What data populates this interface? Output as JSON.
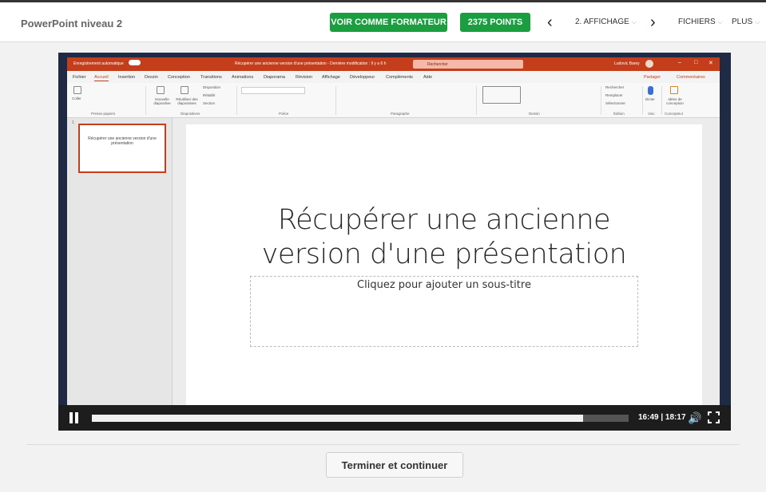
{
  "header": {
    "course_title": "PowerPoint niveau 2",
    "trainer_button": "VOIR COMME FORMATEUR",
    "points_button": "2375 POINTS",
    "lesson_label": "2. AFFICHAGE",
    "files_label": "FICHIERS",
    "more_label": "PLUS",
    "accent": "#1a9e3f"
  },
  "powerpoint": {
    "autosave": "Enregistrement automatique",
    "doc_title": "Récupérer une ancienne version d'une présentation - Dernière modification : Il y a 6 h",
    "search_placeholder": "Rechercher",
    "user": "Ludovic Barey",
    "tabs": [
      "Fichier",
      "Accueil",
      "Insertion",
      "Dessin",
      "Conception",
      "Transitions",
      "Animations",
      "Diaporama",
      "Révision",
      "Affichage",
      "Développeur",
      "Compléments",
      "Aide"
    ],
    "share": "Partager",
    "comments": "Commentaires",
    "groups": [
      "Presse-papiers",
      "Diapositives",
      "Police",
      "Paragraphe",
      "Dessin",
      "Édition",
      "Voix",
      "Concepteur"
    ],
    "ribbon_labels": {
      "paste": "Coller",
      "new_slide": "Nouvelle diapositive",
      "reuse": "Réutiliser des diapositives",
      "layout": "Disposition",
      "reset": "Rétablir",
      "section": "Section",
      "find": "Rechercher",
      "replace": "Remplacer",
      "select": "Sélectionner",
      "dictate": "Dicter",
      "design_ideas": "Idées de conception"
    },
    "slide_number": "1",
    "thumb_text": "Récupérer une ancienne version d'une présentation",
    "slide_title_line1": "Récupérer une ancienne",
    "slide_title_line2": "version d'une présentation",
    "subtitle_placeholder": "Cliquez pour ajouter un sous-titre",
    "brand_color": "#c43e1c"
  },
  "player": {
    "time": "16:49 | 18:17",
    "progress": 0.915
  },
  "footer": {
    "continue_button": "Terminer et continuer"
  }
}
